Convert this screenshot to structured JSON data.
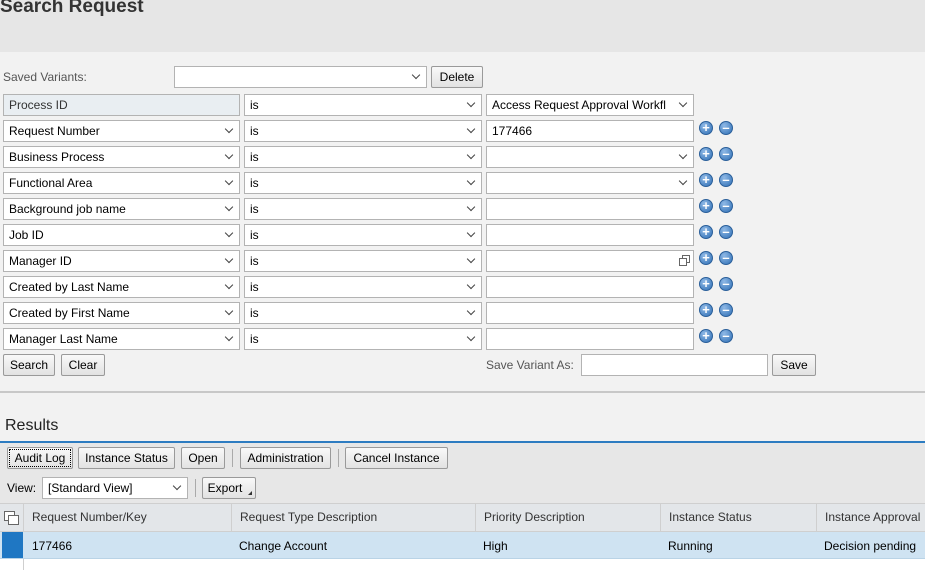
{
  "page": {
    "title": "Search Request"
  },
  "saved_variants": {
    "label": "Saved Variants:",
    "value": "",
    "delete_label": "Delete"
  },
  "criteria": [
    {
      "field": "Process ID",
      "operator": "is",
      "value": "Access Request Approval Workfl",
      "field_type": "readonly",
      "value_type": "dropdown"
    },
    {
      "field": "Request Number",
      "operator": "is",
      "value": "177466",
      "field_type": "dropdown",
      "value_type": "text"
    },
    {
      "field": "Business Process",
      "operator": "is",
      "value": "",
      "field_type": "dropdown",
      "value_type": "dropdown"
    },
    {
      "field": "Functional Area",
      "operator": "is",
      "value": "",
      "field_type": "dropdown",
      "value_type": "dropdown"
    },
    {
      "field": "Background job name",
      "operator": "is",
      "value": "",
      "field_type": "dropdown",
      "value_type": "text"
    },
    {
      "field": "Job ID",
      "operator": "is",
      "value": "",
      "field_type": "dropdown",
      "value_type": "text"
    },
    {
      "field": "Manager ID",
      "operator": "is",
      "value": "",
      "field_type": "dropdown",
      "value_type": "value-help"
    },
    {
      "field": "Created by Last Name",
      "operator": "is",
      "value": "",
      "field_type": "dropdown",
      "value_type": "text"
    },
    {
      "field": "Created by  First Name",
      "operator": "is",
      "value": "",
      "field_type": "dropdown",
      "value_type": "text"
    },
    {
      "field": "Manager Last Name",
      "operator": "is",
      "value": "",
      "field_type": "dropdown",
      "value_type": "text"
    }
  ],
  "row_icons": {
    "add": "+",
    "remove": "–"
  },
  "actions": {
    "search_label": "Search",
    "clear_label": "Clear",
    "save_variant_label": "Save Variant As:",
    "save_variant_value": "",
    "save_label": "Save"
  },
  "results": {
    "title": "Results",
    "toolbar": [
      "Audit Log",
      "Instance Status",
      "Open",
      "Administration",
      "Cancel Instance"
    ],
    "view_label": "View:",
    "view_value": "[Standard View]",
    "export_label": "Export",
    "columns": [
      "Request Number/Key",
      "Request Type Description",
      "Priority Description",
      "Instance Status",
      "Instance Approval"
    ],
    "rows": [
      [
        "177466",
        "Change Account",
        "High",
        "Running",
        "Decision pending"
      ]
    ]
  },
  "colors": {
    "accent": "#2d7cc1",
    "selected_row": "#cfe3f2",
    "icon_blue": "#2f6fb5"
  }
}
